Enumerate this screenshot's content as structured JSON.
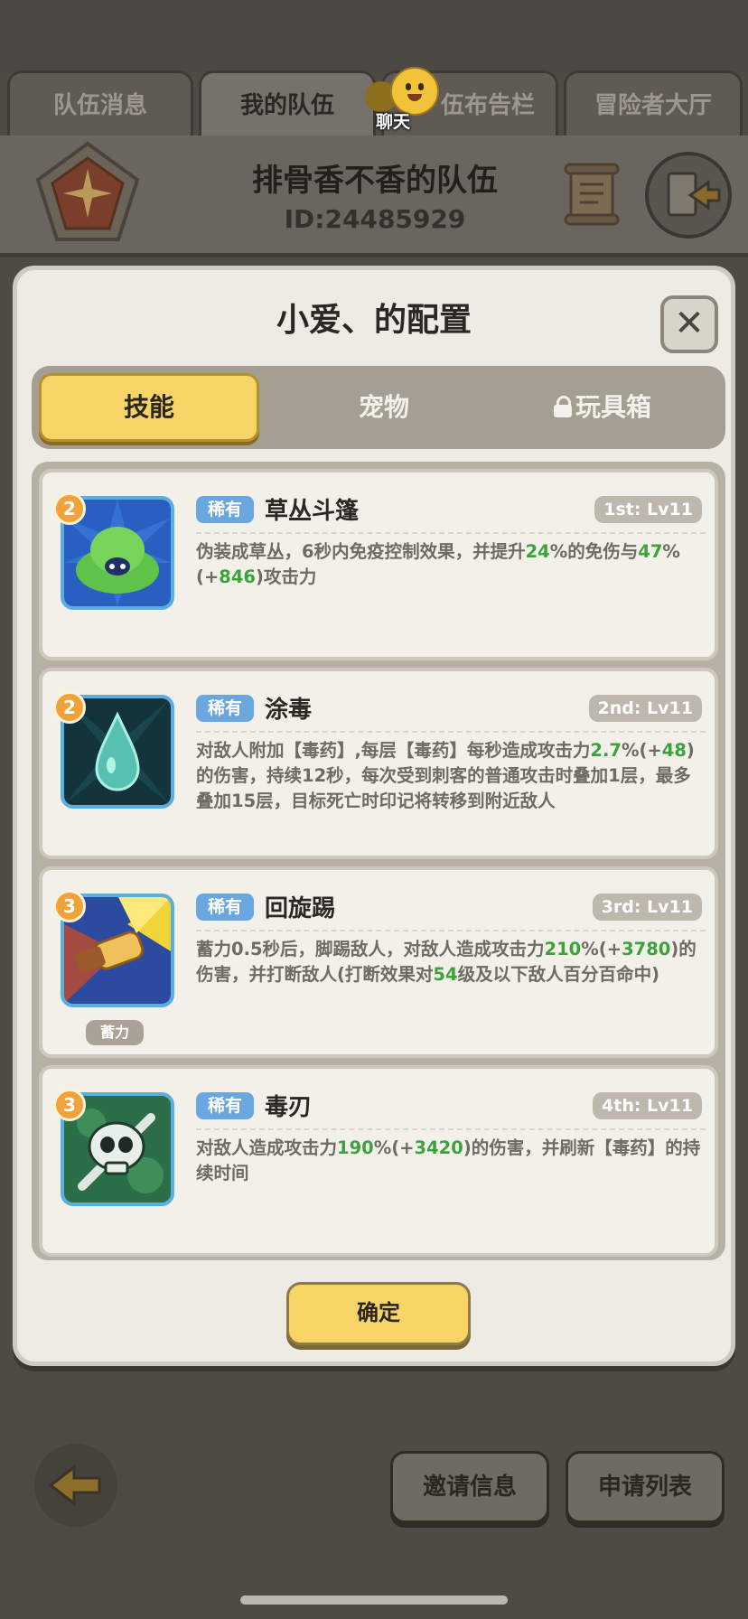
{
  "top_tabs": [
    {
      "label": "队伍消息"
    },
    {
      "label": "我的队伍"
    },
    {
      "label": "伍布告栏"
    },
    {
      "label": "冒险者大厅"
    }
  ],
  "chat": {
    "label": "聊天"
  },
  "team": {
    "name": "排骨香不香的队伍",
    "id_text": "ID:24485929"
  },
  "modal": {
    "title": "小爱、的配置",
    "close_label": "✕",
    "tabs": [
      {
        "label": "技能"
      },
      {
        "label": "宠物"
      },
      {
        "label": "玩具箱"
      }
    ],
    "confirm_label": "确定"
  },
  "skills": [
    {
      "number": "2",
      "rarity": "稀有",
      "name": "草丛斗篷",
      "level": "1st: Lv11",
      "desc": [
        "伪装成草丛，6秒内免疫控制效果，并提升",
        {
          "hl": "24"
        },
        "%的免伤与",
        {
          "hl": "47"
        },
        "%(+",
        {
          "hl": "846"
        },
        ")攻击力"
      ]
    },
    {
      "number": "2",
      "rarity": "稀有",
      "name": "涂毒",
      "level": "2nd: Lv11",
      "desc": [
        "对敌人附加【毒药】,每层【毒药】每秒造成攻击力",
        {
          "hl": "2.7"
        },
        "%(+",
        {
          "hl": "48"
        },
        ")的伤害，持续12秒，每次受到刺客的普通攻击时叠加1层，最多叠加15层，目标死亡时印记将转移到附近敌人"
      ]
    },
    {
      "number": "3",
      "rarity": "稀有",
      "name": "回旋踢",
      "level": "3rd: Lv11",
      "badge": "蓄力",
      "desc": [
        "蓄力0.5秒后，脚踢敌人，对敌人造成攻击力",
        {
          "hl": "210"
        },
        "%(+",
        {
          "hl": "3780"
        },
        ")的伤害，并打断敌人(打断效果对",
        {
          "hl": "54"
        },
        "级及以下敌人百分百命中)"
      ]
    },
    {
      "number": "3",
      "rarity": "稀有",
      "name": "毒刃",
      "level": "4th: Lv11",
      "desc": [
        "对敌人造成攻击力",
        {
          "hl": "190"
        },
        "%(+",
        {
          "hl": "3420"
        },
        ")的伤害，并刷新【毒药】的持续时间"
      ]
    }
  ],
  "bottom": {
    "invite_label": "邀请信息",
    "apply_label": "申请列表"
  },
  "colors": {
    "accent_yellow": "#f6d566",
    "highlight_green": "#3ca33c",
    "rarity_blue": "#6aa7e0"
  },
  "icons": {
    "chat": "chat-bubble-icon",
    "back": "back-arrow-icon",
    "exit": "exit-door-icon",
    "scroll": "scroll-icon",
    "lock": "lock-icon"
  }
}
